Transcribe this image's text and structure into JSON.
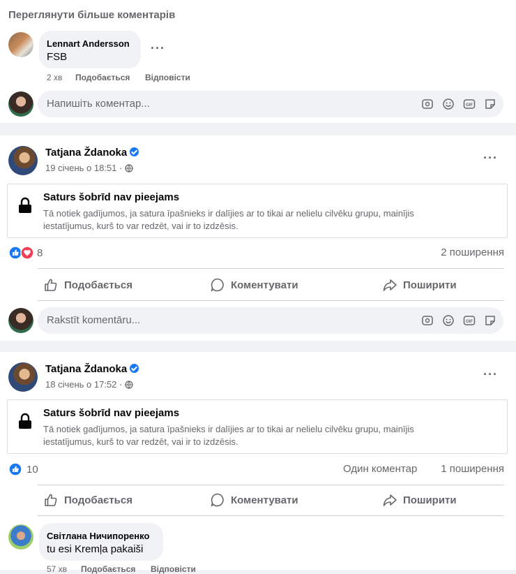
{
  "top_comments": {
    "view_more": "Переглянути більше коментарів",
    "comment": {
      "author": "Lennart Andersson",
      "text": "FSB",
      "time": "2 хв",
      "like": "Подобається",
      "reply": "Відповісти"
    },
    "composer_placeholder": "Напишіть коментар..."
  },
  "posts": [
    {
      "author": "Tatjana Ždanoka",
      "date": "19 січень о 18:51 ·",
      "locked_title": "Saturs šobrīd nav pieejams",
      "locked_desc": "Tā notiek gadījumos, ja satura īpašnieks ir dalījies ar to tikai ar nelielu cilvēku grupu, mainījis iestatījumus, kurš to var redzēt, vai ir to izdzēsis.",
      "reaction_count": "8",
      "shares": "2 поширення",
      "comments_count": "",
      "actions": {
        "like": "Подобається",
        "comment": "Коментувати",
        "share": "Поширити"
      },
      "composer_placeholder": "Rakstīt komentāru..."
    },
    {
      "author": "Tatjana Ždanoka",
      "date": "18 січень о 17:52 ·",
      "locked_title": "Saturs šobrīd nav pieejams",
      "locked_desc": "Tā notiek gadījumos, ja satura īpašnieks ir dalījies ar to tikai ar nelielu cilvēku grupu, mainījis iestatījumus, kurš to var redzēt, vai ir to izdzēsis.",
      "reaction_count": "10",
      "shares": "1 поширення",
      "comments_count": "Один коментар",
      "actions": {
        "like": "Подобається",
        "comment": "Коментувати",
        "share": "Поширити"
      },
      "comment": {
        "author": "Світлана Ничипоренко",
        "text": "tu esi Kremļa pakaiši",
        "time": "57 хв",
        "like": "Подобається",
        "reply": "Відповісти"
      }
    }
  ],
  "colors": {
    "accent": "#1877f2",
    "love": "#f33e58",
    "muted": "#65676b",
    "bubble": "#f0f2f5"
  }
}
